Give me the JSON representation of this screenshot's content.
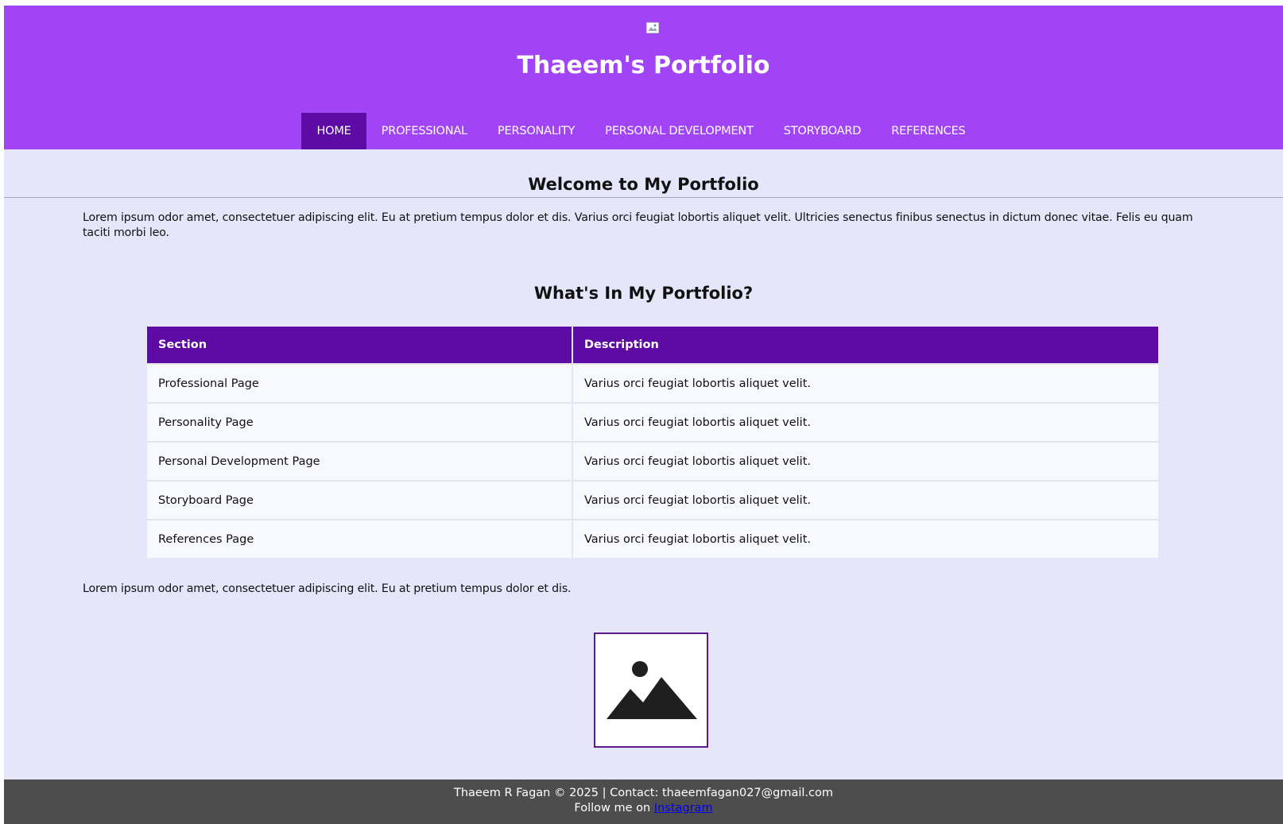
{
  "header": {
    "title": "Thaeem's Portfolio",
    "background_color": "#a144f5",
    "logo_icon": "broken-image-icon"
  },
  "nav": {
    "items": [
      {
        "label": "HOME",
        "active": true
      },
      {
        "label": "PROFESSIONAL",
        "active": false
      },
      {
        "label": "PERSONALITY",
        "active": false
      },
      {
        "label": "PERSONAL DEVELOPMENT",
        "active": false
      },
      {
        "label": "STORYBOARD",
        "active": false
      },
      {
        "label": "REFERENCES",
        "active": false
      }
    ],
    "active_color": "#5e0aa4"
  },
  "main": {
    "welcome_title": "Welcome to My Portfolio",
    "intro_text": "Lorem ipsum odor amet, consectetuer adipiscing elit. Eu at pretium tempus dolor et dis. Varius orci feugiat lobortis aliquet velit. Ultricies senectus finibus senectus in dictum donec vitae. Felis eu quam taciti morbi leo.",
    "portfolio_title": "What's In My Portfolio?",
    "table": {
      "headers": [
        "Section",
        "Description"
      ],
      "rows": [
        [
          "Professional Page",
          "Varius orci feugiat lobortis aliquet velit."
        ],
        [
          "Personality Page",
          "Varius orci feugiat lobortis aliquet velit."
        ],
        [
          "Personal Development Page",
          "Varius orci feugiat lobortis aliquet velit."
        ],
        [
          "Storyboard Page",
          "Varius orci feugiat lobortis aliquet velit."
        ],
        [
          "References Page",
          "Varius orci feugiat lobortis aliquet velit."
        ]
      ],
      "header_color": "#5e0aa4"
    },
    "outro_text": "Lorem ipsum odor amet, consectetuer adipiscing elit. Eu at pretium tempus dolor et dis.",
    "image_icon": "image-placeholder-icon"
  },
  "footer": {
    "line1": "Thaeem R Fagan © 2025 | Contact: thaeemfagan027@gmail.com",
    "follow_prefix": "Follow me on ",
    "link_label": "Instagram",
    "background_color": "#4d4d4d"
  },
  "colors": {
    "page_background": "#e6e6fa"
  }
}
